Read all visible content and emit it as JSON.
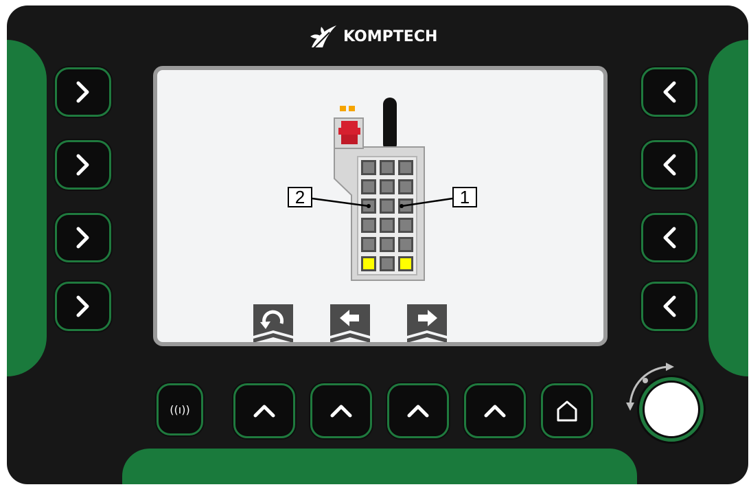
{
  "brand": {
    "name": "KOMPTECH"
  },
  "left_keys": [
    {
      "id": "left-key-1",
      "icon": "chevron-right-icon"
    },
    {
      "id": "left-key-2",
      "icon": "chevron-right-icon"
    },
    {
      "id": "left-key-3",
      "icon": "chevron-right-icon"
    },
    {
      "id": "left-key-4",
      "icon": "chevron-right-icon"
    }
  ],
  "right_keys": [
    {
      "id": "right-key-1",
      "icon": "chevron-left-icon"
    },
    {
      "id": "right-key-2",
      "icon": "chevron-left-icon"
    },
    {
      "id": "right-key-3",
      "icon": "chevron-left-icon"
    },
    {
      "id": "right-key-4",
      "icon": "chevron-left-icon"
    }
  ],
  "bottom_keys": [
    {
      "id": "radio",
      "icon": "radio-signal-icon",
      "label": "((ı))"
    },
    {
      "id": "up-1",
      "icon": "chevron-up-icon"
    },
    {
      "id": "up-2",
      "icon": "chevron-up-icon"
    },
    {
      "id": "up-3",
      "icon": "chevron-up-icon"
    },
    {
      "id": "up-4",
      "icon": "chevron-up-icon"
    },
    {
      "id": "home",
      "icon": "home-icon"
    }
  ],
  "screen": {
    "callouts": {
      "left": "2",
      "right": "1"
    },
    "softkeys": [
      {
        "id": "back",
        "icon": "undo-icon"
      },
      {
        "id": "prev",
        "icon": "arrow-left-icon"
      },
      {
        "id": "next",
        "icon": "arrow-right-icon"
      }
    ]
  },
  "colors": {
    "bezel": "#171717",
    "accent_green": "#1f7a3e",
    "key_yellow": "#ffff00",
    "stop_red": "#d6202f",
    "indicator_orange": "#f5a400"
  }
}
